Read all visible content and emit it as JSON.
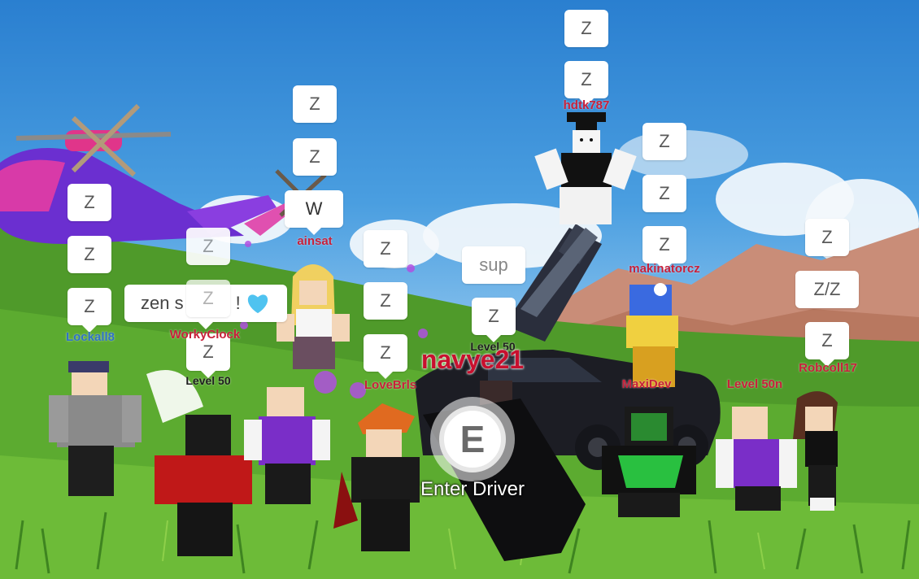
{
  "interaction_prompt": {
    "key": "E",
    "action": "Enter Driver"
  },
  "chat_bubbles": [
    {
      "id": "hdtk-1",
      "text": "Z"
    },
    {
      "id": "hdtk-2",
      "text": "Z"
    },
    {
      "id": "ainsat-1",
      "text": "Z"
    },
    {
      "id": "ainsat-2",
      "text": "Z"
    },
    {
      "id": "ainsat-3",
      "text": "W"
    },
    {
      "id": "left-1",
      "text": "Z"
    },
    {
      "id": "left-2",
      "text": "Z"
    },
    {
      "id": "left-3",
      "text": "Z"
    },
    {
      "id": "wonky-1",
      "text": "Z"
    },
    {
      "id": "wonky-2",
      "text": "Z"
    },
    {
      "id": "wonky-3",
      "text": "Z"
    },
    {
      "id": "zen-msg",
      "text": "zen s",
      "suffix": "!"
    },
    {
      "id": "mid-1",
      "text": "Z"
    },
    {
      "id": "mid-2",
      "text": "Z"
    },
    {
      "id": "mid-3",
      "text": "Z"
    },
    {
      "id": "sup",
      "text": "sup"
    },
    {
      "id": "navye-1",
      "text": "Z"
    },
    {
      "id": "mak-1",
      "text": "Z"
    },
    {
      "id": "mak-2",
      "text": "Z"
    },
    {
      "id": "mak-3",
      "text": "Z"
    },
    {
      "id": "rob-1",
      "text": "Z"
    },
    {
      "id": "rob-2",
      "text": "Z/Z"
    },
    {
      "id": "rob-3",
      "text": "Z"
    }
  ],
  "players": [
    {
      "name": "hdtk787",
      "color": "red"
    },
    {
      "name": "ainsat",
      "color": "red"
    },
    {
      "name": "Lockall8",
      "color": "blue"
    },
    {
      "name": "WorkyClock",
      "color": "red"
    },
    {
      "name": "Level 50",
      "color": "dark"
    },
    {
      "name": "LoveBrls",
      "color": "red"
    },
    {
      "name": "Level 50",
      "color": "dark"
    },
    {
      "name": "navye21",
      "color": "big"
    },
    {
      "name": "makinatorcz",
      "color": "red"
    },
    {
      "name": "MaxiDev",
      "color": "red"
    },
    {
      "name": "Level 50n",
      "color": "red"
    },
    {
      "name": "Robcoll17",
      "color": "red"
    }
  ],
  "colors": {
    "name_red": "#c8203a",
    "name_blue": "#2f72c8",
    "heart": "#4fc3f0"
  }
}
